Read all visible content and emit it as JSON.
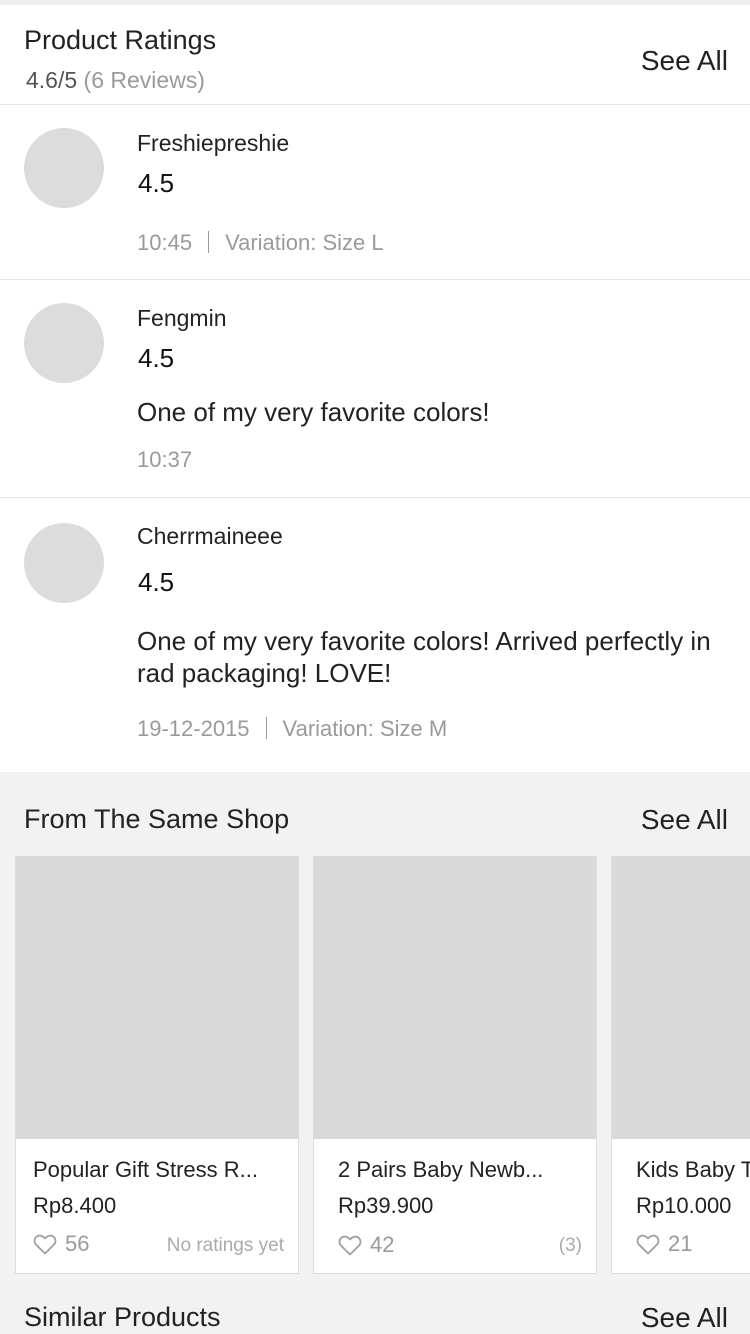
{
  "product_ratings": {
    "title": "Product Ratings",
    "score": "4.6/5",
    "count": "(6 Reviews)",
    "see_all": "See All"
  },
  "reviews": [
    {
      "name": "Freshiepreshie",
      "score": "4.5",
      "comment": "",
      "date": "10:45",
      "variation": "Variation: Size L"
    },
    {
      "name": "Fengmin",
      "score": "4.5",
      "comment": "One of my very favorite colors!",
      "date": "10:37",
      "variation": ""
    },
    {
      "name": "Cherrmaineee",
      "score": "4.5",
      "comment": "One of my very favorite colors! Arrived perfectly in rad packaging! LOVE!",
      "date": "19-12-2015",
      "variation": "Variation: Size M"
    }
  ],
  "same_shop": {
    "title": "From The Same Shop",
    "see_all": "See All",
    "products": [
      {
        "name": "Popular Gift Stress R...",
        "price": "Rp8.400",
        "likes": "56",
        "rating_note": "No ratings yet"
      },
      {
        "name": "2 Pairs Baby Newb...",
        "price": "Rp39.900",
        "likes": "42",
        "rating_note": "(3)"
      },
      {
        "name": "Kids Baby T",
        "price": "Rp10.000",
        "likes": "21",
        "rating_note": ""
      }
    ]
  },
  "similar_products": {
    "title": "Similar Products",
    "see_all": "See All"
  },
  "icons": {
    "like": "heart-outline-icon"
  },
  "colors": {
    "muted_text": "#9a9a9a",
    "placeholder": "#d9d9d9",
    "background": "#f2f2f2"
  }
}
